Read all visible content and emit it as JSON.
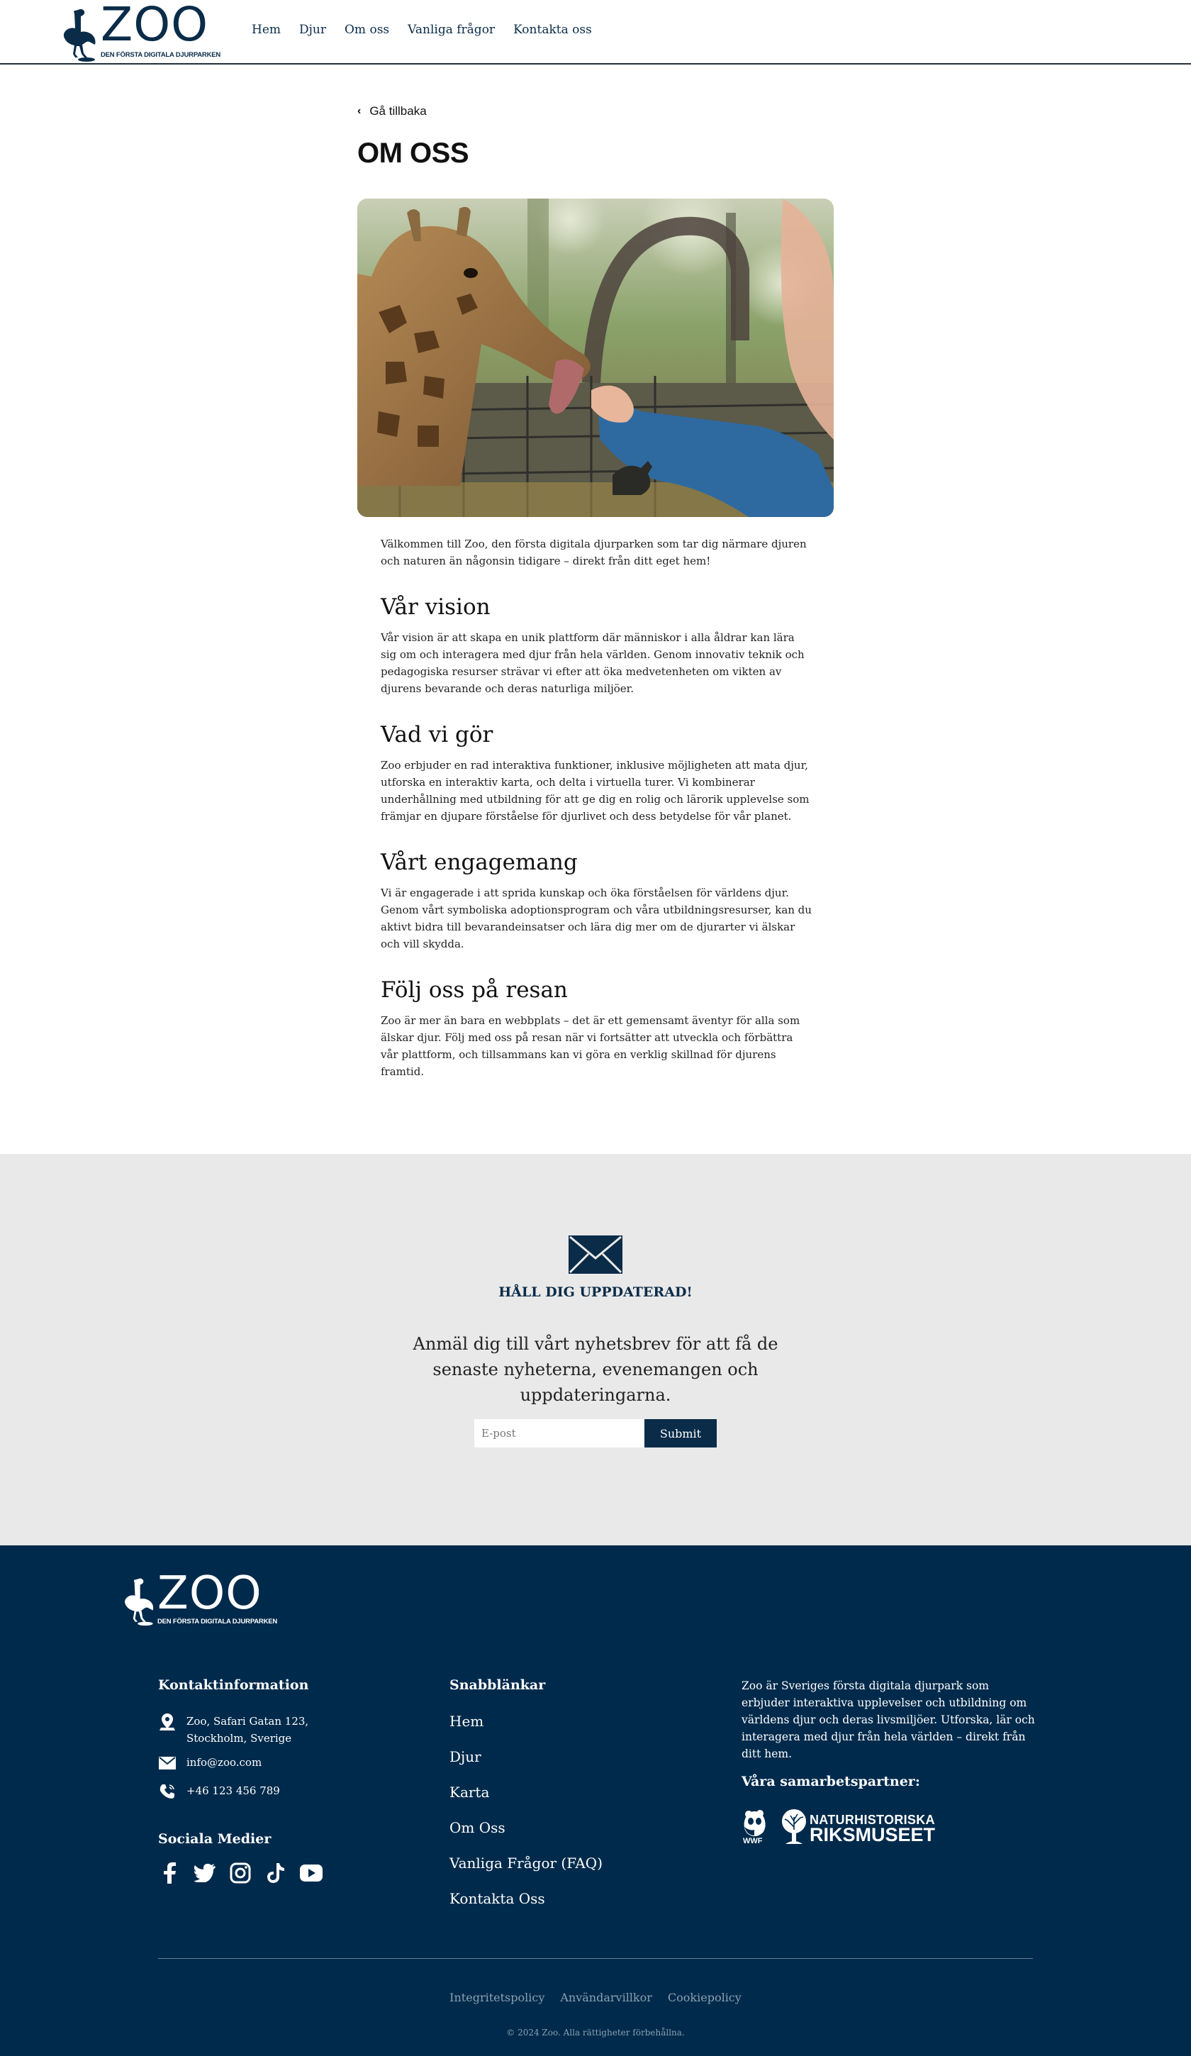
{
  "header": {
    "logo_word": "ZOO",
    "logo_tagline": "DEN FÖRSTA DIGITALA DJURPARKEN",
    "nav": [
      "Hem",
      "Djur",
      "Om oss",
      "Vanliga frågor",
      "Kontakta oss"
    ]
  },
  "main": {
    "back_label": "Gå tillbaka",
    "title": "OM OSS",
    "intro": "Välkommen till Zoo, den första digitala djurparken som tar dig närmare djuren och naturen än någonsin tidigare – direkt från ditt eget hem!",
    "sections": [
      {
        "heading": "Vår vision",
        "body": "Vår vision är att skapa en unik plattform där människor i alla åldrar kan lära sig om och interagera med djur från hela världen. Genom innovativ teknik och pedagogiska resurser strävar vi efter att öka medvetenheten om vikten av djurens bevarande och deras naturliga miljöer."
      },
      {
        "heading": "Vad vi gör",
        "body": "Zoo erbjuder en rad interaktiva funktioner, inklusive möjligheten att mata djur, utforska en interaktiv karta, och delta i virtuella turer. Vi kombinerar underhållning med utbildning för att ge dig en rolig och lärorik upplevelse som främjar en djupare förståelse för djurlivet och dess betydelse för vår planet."
      },
      {
        "heading": "Vårt engagemang",
        "body": "Vi är engagerade i att sprida kunskap och öka förståelsen för världens djur. Genom vårt symboliska adoptionsprogram och våra utbildningsresurser, kan du aktivt bidra till bevarandeinsatser och lära dig mer om de djurarter vi älskar och vill skydda."
      },
      {
        "heading": "Följ oss på resan",
        "body": "Zoo är mer än bara en webbplats – det är ett gemensamt äventyr för alla som älskar djur. Följ med oss på resan när vi fortsätter att utveckla och förbättra vår plattform, och tillsammans kan vi göra en verklig skillnad för djurens framtid."
      }
    ]
  },
  "newsletter": {
    "heading": "HÅLL DIG UPPDATERAD!",
    "text": "Anmäl dig till vårt nyhetsbrev för att få de senaste nyheterna, evenemangen och uppdateringarna.",
    "email_placeholder": "E-post",
    "submit_label": "Submit"
  },
  "footer": {
    "logo_word": "ZOO",
    "logo_tagline": "DEN FÖRSTA DIGITALA DJURPARKEN",
    "contact_title": "Kontaktinformation",
    "address_line1": "Zoo, Safari Gatan 123,",
    "address_line2": "Stockholm, Sverige",
    "email": "info@zoo.com",
    "phone": "+46 123 456 789",
    "social_title": "Sociala Medier",
    "social_icons": [
      "facebook-icon",
      "twitter-icon",
      "instagram-icon",
      "tiktok-icon",
      "youtube-icon"
    ],
    "quicklinks_title": "Snabblänkar",
    "quicklinks": [
      "Hem",
      "Djur",
      "Karta",
      "Om Oss",
      "Vanliga Frågor (FAQ)",
      "Kontakta Oss"
    ],
    "about": "Zoo är Sveriges första digitala djurpark som erbjuder interaktiva upplevelser och utbildning om världens djur och deras livsmiljöer. Utforska, lär och interagera med djur från hela världen – direkt från ditt hem.",
    "partners_title": "Våra samarbetspartner:",
    "partner_wwf": "WWF",
    "partner_nrm_line1": "NATURHISTORISKA",
    "partner_nrm_line2": "RIKSMUSEET",
    "legal": [
      "Integritetspolicy",
      "Användarvillkor",
      "Cookiepolicy"
    ],
    "copyright": "© 2024 Zoo. Alla rättigheter förbehållna."
  },
  "colors": {
    "brand_navy": "#0a2c49",
    "footer_bg": "#002a4b",
    "newsletter_bg": "#e9e9e9"
  }
}
